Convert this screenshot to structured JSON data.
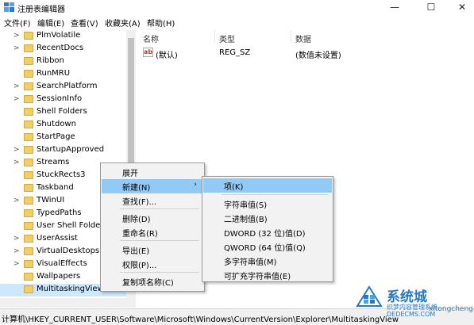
{
  "window": {
    "title": "注册表编辑器",
    "minimize": "—",
    "maximize": "☐",
    "close": "✕"
  },
  "menu": [
    "文件(F)",
    "编辑(E)",
    "查看(V)",
    "收藏夹(A)",
    "帮助(H)"
  ],
  "tree": {
    "items": [
      {
        "label": "PlmVolatile",
        "expandable": true
      },
      {
        "label": "RecentDocs",
        "expandable": true
      },
      {
        "label": "Ribbon",
        "expandable": false
      },
      {
        "label": "RunMRU",
        "expandable": false
      },
      {
        "label": "SearchPlatform",
        "expandable": true
      },
      {
        "label": "SessionInfo",
        "expandable": true
      },
      {
        "label": "Shell Folders",
        "expandable": false
      },
      {
        "label": "Shutdown",
        "expandable": false
      },
      {
        "label": "StartPage",
        "expandable": false
      },
      {
        "label": "StartupApproved",
        "expandable": true
      },
      {
        "label": "Streams",
        "expandable": true
      },
      {
        "label": "StuckRects3",
        "expandable": false
      },
      {
        "label": "Taskband",
        "expandable": false
      },
      {
        "label": "TWinUI",
        "expandable": true
      },
      {
        "label": "TypedPaths",
        "expandable": false
      },
      {
        "label": "User Shell Folder",
        "expandable": false
      },
      {
        "label": "UserAssist",
        "expandable": true
      },
      {
        "label": "VirtualDesktops",
        "expandable": true
      },
      {
        "label": "VisualEffects",
        "expandable": true
      },
      {
        "label": "Wallpapers",
        "expandable": false
      },
      {
        "label": "MultitaskingView",
        "expandable": false,
        "selected": true
      }
    ]
  },
  "list": {
    "headers": [
      "名称",
      "类型",
      "数据"
    ],
    "rows": [
      {
        "name": "(默认)",
        "type": "REG_SZ",
        "data": "(数值未设置)",
        "icon": "ab"
      }
    ]
  },
  "context_menu": {
    "items": [
      {
        "label": "展开"
      },
      {
        "label": "新建(N)",
        "submenu": true,
        "highlighted": true
      },
      {
        "label": "查找(F)..."
      },
      {
        "label": "删除(D)"
      },
      {
        "label": "重命名(R)"
      },
      {
        "label": "导出(E)"
      },
      {
        "label": "权限(P)..."
      },
      {
        "label": "复制项名称(C)"
      }
    ],
    "submenu_arrow": "›"
  },
  "submenu": {
    "items": [
      {
        "label": "项(K)",
        "highlighted": true
      },
      {
        "label": "字符串值(S)"
      },
      {
        "label": "二进制值(B)"
      },
      {
        "label": "DWORD (32 位)值(D)"
      },
      {
        "label": "QWORD (64 位)值(Q)"
      },
      {
        "label": "多字符串值(M)"
      },
      {
        "label": "可扩充字符串值(E)"
      }
    ]
  },
  "status": {
    "path": "计算机\\HKEY_CURRENT_USER\\Software\\Microsoft\\Windows\\CurrentVersion\\Explorer\\MultitaskingView"
  },
  "watermark": {
    "name": "系统城",
    "line1": "织梦内容管理系统",
    "line2": "DEDECMS.COM",
    "line3": "xitongcheng.com"
  },
  "colors": {
    "selection": "#cce8ff",
    "menu_highlight": "#91c9f7",
    "folder": "#f0cf6a",
    "watermark": "#2a78c2"
  }
}
